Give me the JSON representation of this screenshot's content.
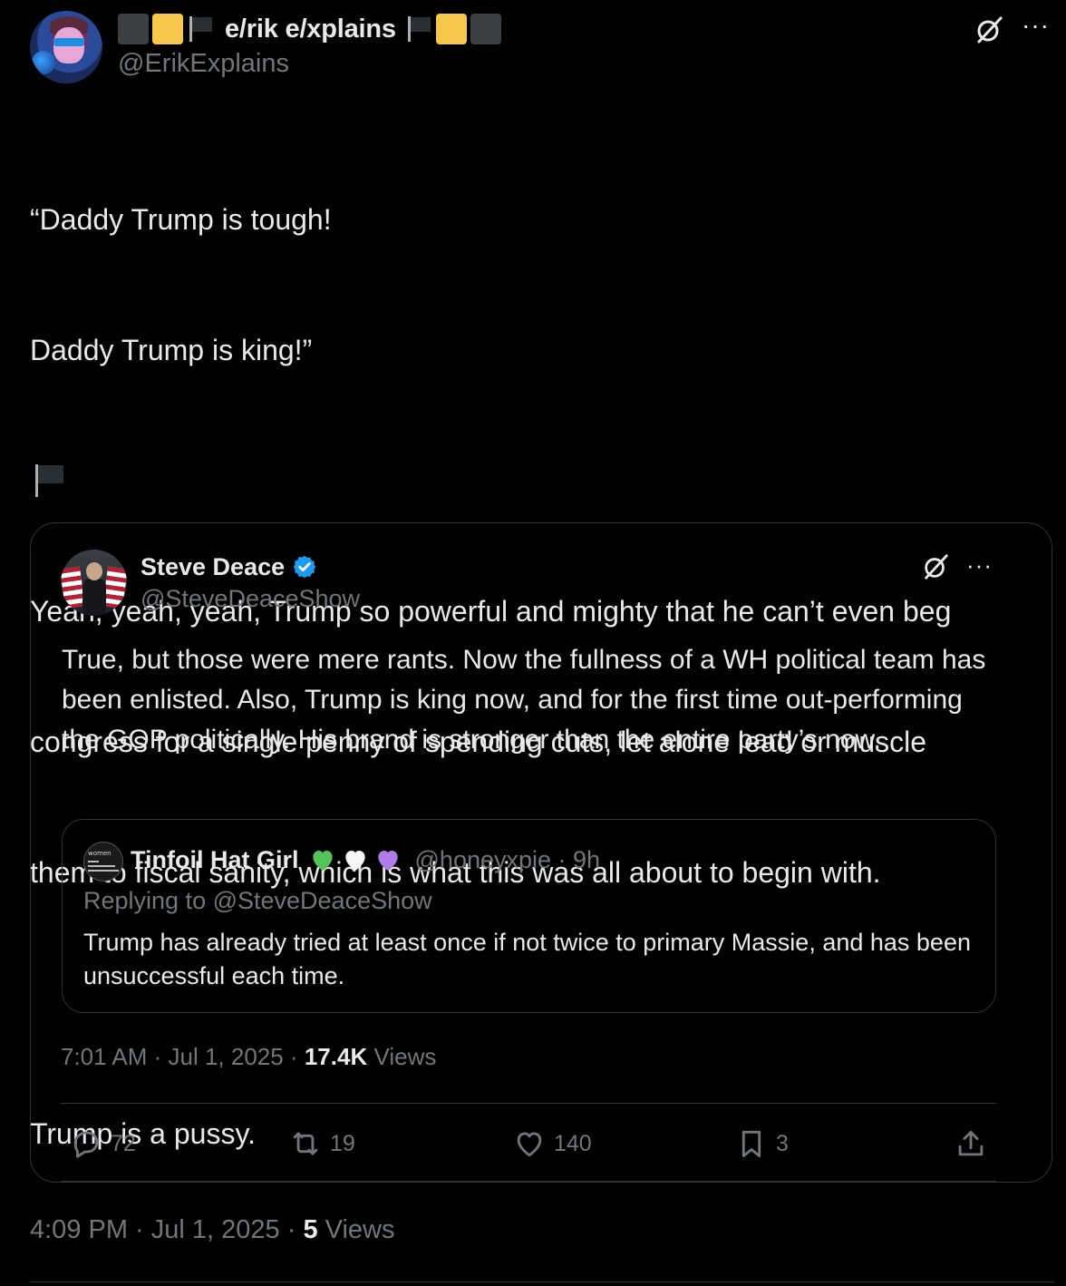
{
  "tweet": {
    "author": {
      "display_name": "e/rik e/xplains",
      "handle": "@ErikExplains"
    },
    "text_lines": [
      "“Daddy Trump is tough!",
      "Daddy Trump is king!”",
      "",
      "Yeah, yeah, yeah, Trump so powerful and mighty that he can’t even beg",
      "congress for a single penny of spending cuts, let alone lead or muscle",
      "them to fiscal sanity, which is what this was all about to begin with.",
      "",
      "Trump is a pussy."
    ],
    "time": "4:09 PM",
    "date": "Jul 1, 2025",
    "views_count": "5",
    "views_label": "Views"
  },
  "quote": {
    "author": {
      "display_name": "Steve Deace",
      "handle": "@SteveDeaceShow"
    },
    "text": "True, but those were mere rants. Now the fullness of a WH political team has been enlisted. Also, Trump is king now, and for the first time out-performing the GOP politically. His brand is stronger than the entire party’s now.",
    "time": "7:01 AM",
    "date": "Jul 1, 2025",
    "views_count": "17.4K",
    "views_label": "Views",
    "actions": {
      "replies": "72",
      "reposts": "19",
      "likes": "140",
      "bookmarks": "3"
    }
  },
  "nested_quote": {
    "author": {
      "display_name": "Tinfoil Hat Girl",
      "handle": "@honeyxpie",
      "age": "9h"
    },
    "replying_to": "Replying to @SteveDeaceShow",
    "text": "Trump has already tried at least once if not twice to primary Massie, and has been unsuccessful each time.",
    "avatar_text": "women"
  },
  "colors": {
    "background": "#000000",
    "text": "#e7e9ea",
    "muted": "#71767b",
    "border": "#2f3336",
    "verified": "#1d9bf0",
    "heart_green": "#56c35a",
    "heart_white": "#f5f5f5",
    "heart_purple": "#b07ce8"
  }
}
